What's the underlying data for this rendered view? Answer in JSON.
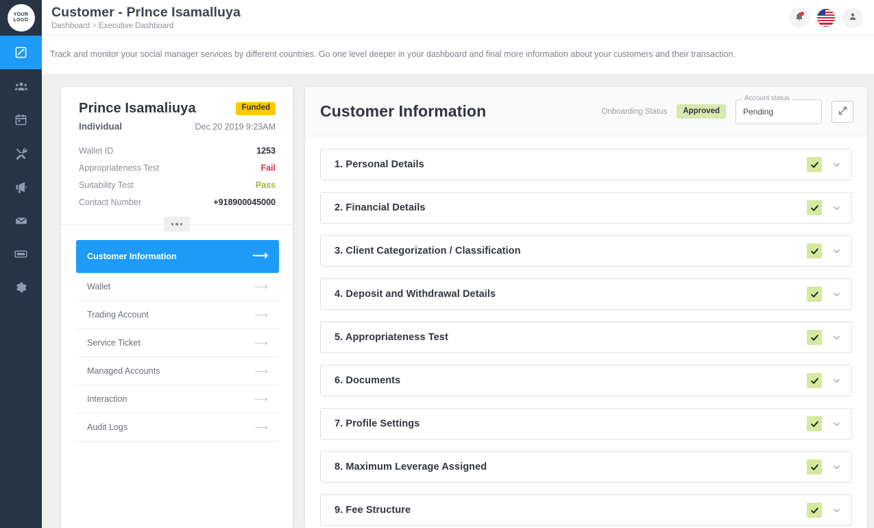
{
  "brand": {
    "logo_line1": "YOUR",
    "logo_line2": "LOGO",
    "accent": "#1d9bf6",
    "rail_bg": "#263445"
  },
  "header": {
    "title": "Customer - PrInce Isamalluya",
    "breadcrumb_root": "Dashboard",
    "breadcrumb_sep": ">",
    "breadcrumb_current": "Executive Dashboard"
  },
  "banner": {
    "text": "Track and monitor your social manager services by different countries. Go one level deeper in your dashboard and final more information about your customers and their transaction."
  },
  "rail": {
    "items": [
      {
        "name": "dashboard",
        "icon": "dashboard-icon",
        "active": true
      },
      {
        "name": "users",
        "icon": "users-icon",
        "active": false
      },
      {
        "name": "calendar",
        "icon": "calendar-icon",
        "active": false
      },
      {
        "name": "tools",
        "icon": "tools-icon",
        "active": false
      },
      {
        "name": "announcements",
        "icon": "megaphone-icon",
        "active": false
      },
      {
        "name": "mail",
        "icon": "envelope-icon",
        "active": false
      },
      {
        "name": "tickets",
        "icon": "ticket-icon",
        "active": false
      },
      {
        "name": "settings",
        "icon": "gear-icon",
        "active": false
      }
    ]
  },
  "topbar_actions": {
    "notifications_icon": "bell-icon",
    "language_icon": "us-flag-icon",
    "profile_icon": "user-avatar-icon"
  },
  "customer": {
    "name": "Prince Isamaliuya",
    "status_badge": "Funded",
    "status_badge_color": "#ffc800",
    "type": "Individual",
    "date": "Dec 20 2019 9:23AM",
    "details": [
      {
        "key": "Wallet ID",
        "value": "1253",
        "tone": ""
      },
      {
        "key": "Appropriateness Test",
        "value": "Fail",
        "tone": "fail"
      },
      {
        "key": "Suitability Test",
        "value": "Pass",
        "tone": "pass"
      },
      {
        "key": "Contact Number",
        "value": "+918900045000",
        "tone": ""
      }
    ],
    "more_label": "•••",
    "nav": [
      {
        "label": "Customer Information",
        "active": true
      },
      {
        "label": "Wallet",
        "active": false
      },
      {
        "label": "Trading Account",
        "active": false
      },
      {
        "label": "Service Ticket",
        "active": false
      },
      {
        "label": "Managed Accounts",
        "active": false
      },
      {
        "label": "Interaction",
        "active": false
      },
      {
        "label": "Audit Logs",
        "active": false
      }
    ]
  },
  "main": {
    "title": "Customer Information",
    "onboarding_label": "Onboarding Status",
    "onboarding_value": "Approved",
    "onboarding_color": "#d7e8b0",
    "account_status_legend": "Account status",
    "account_status_value": "Pending",
    "expand_icon": "expand-arrows-icon",
    "sections": [
      {
        "title": "1. Personal Details",
        "complete": true
      },
      {
        "title": "2. Financial Details",
        "complete": true
      },
      {
        "title": "3. Client Categorization / Classification",
        "complete": true
      },
      {
        "title": "4. Deposit and Withdrawal Details",
        "complete": true
      },
      {
        "title": "5. Appropriateness Test",
        "complete": true
      },
      {
        "title": "6. Documents",
        "complete": true
      },
      {
        "title": "7. Profile Settings",
        "complete": true
      },
      {
        "title": "8. Maximum Leverage Assigned",
        "complete": true
      },
      {
        "title": "9. Fee Structure",
        "complete": true
      }
    ]
  }
}
